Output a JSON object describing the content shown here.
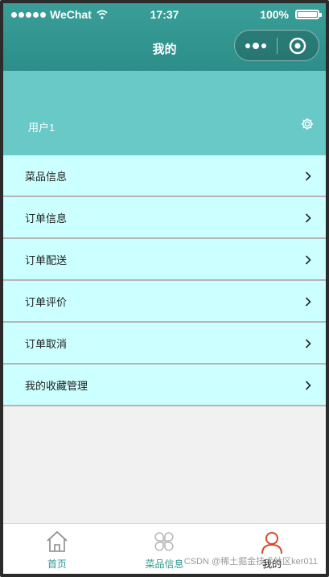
{
  "status_bar": {
    "carrier": "WeChat",
    "time": "17:37",
    "battery": "100%"
  },
  "nav": {
    "title": "我的"
  },
  "profile": {
    "username": "用户1"
  },
  "menu": {
    "items": [
      {
        "label": "菜品信息"
      },
      {
        "label": "订单信息"
      },
      {
        "label": "订单配送"
      },
      {
        "label": "订单评价"
      },
      {
        "label": "订单取消"
      },
      {
        "label": "我的收藏管理"
      }
    ]
  },
  "tabbar": {
    "tabs": [
      {
        "label": "首页",
        "icon": "home-icon"
      },
      {
        "label": "菜品信息",
        "icon": "clover-icon"
      },
      {
        "label": "我的",
        "icon": "user-icon"
      }
    ]
  },
  "watermark": "CSDN @稀土掘金技术社区ker011",
  "colors": {
    "header": "#2d8e89",
    "profile_bg": "#69c9c6",
    "menu_bg": "#ccffff",
    "active_tab": "#d9472b"
  }
}
